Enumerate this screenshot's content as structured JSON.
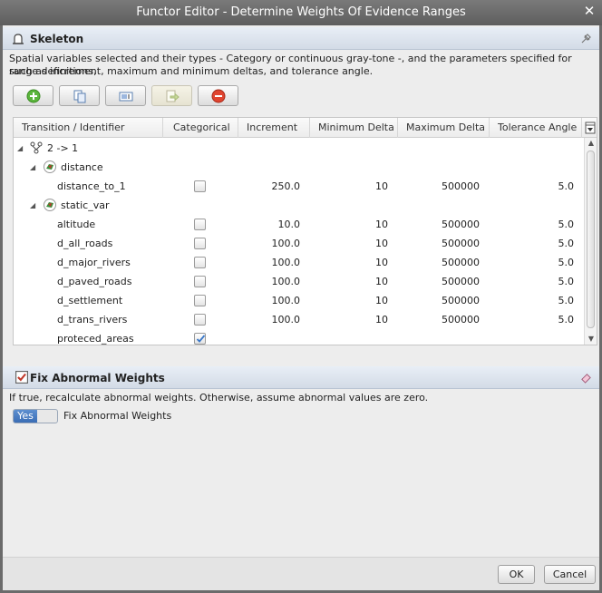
{
  "window": {
    "title": "Functor Editor - Determine Weights Of Evidence Ranges"
  },
  "skeleton": {
    "title": "Skeleton",
    "description_line1": "Spatial variables selected and their types - Category or continuous gray-tone -, and the parameters specified for range definitions,",
    "description_line2": "such as increment, maximum and minimum deltas, and tolerance angle."
  },
  "toolbar": {
    "buttons": [
      {
        "icon": "add-icon"
      },
      {
        "icon": "copy-icon"
      },
      {
        "icon": "edit-icon"
      },
      {
        "icon": "import-icon"
      },
      {
        "icon": "remove-icon"
      }
    ]
  },
  "grid": {
    "columns": [
      "Transition / Identifier",
      "Categorical",
      "Increment",
      "Minimum Delta",
      "Maximum Delta",
      "Tolerance Angle"
    ],
    "rows": [
      {
        "type": "root",
        "label": "2 -> 1"
      },
      {
        "type": "group",
        "label": "distance"
      },
      {
        "type": "var",
        "label": "distance_to_1",
        "categorical": false,
        "increment": "250.0",
        "min_delta": "10",
        "max_delta": "500000",
        "tolerance": "5.0"
      },
      {
        "type": "group",
        "label": "static_var"
      },
      {
        "type": "var",
        "label": "altitude",
        "categorical": false,
        "increment": "10.0",
        "min_delta": "10",
        "max_delta": "500000",
        "tolerance": "5.0"
      },
      {
        "type": "var",
        "label": "d_all_roads",
        "categorical": false,
        "increment": "100.0",
        "min_delta": "10",
        "max_delta": "500000",
        "tolerance": "5.0"
      },
      {
        "type": "var",
        "label": "d_major_rivers",
        "categorical": false,
        "increment": "100.0",
        "min_delta": "10",
        "max_delta": "500000",
        "tolerance": "5.0"
      },
      {
        "type": "var",
        "label": "d_paved_roads",
        "categorical": false,
        "increment": "100.0",
        "min_delta": "10",
        "max_delta": "500000",
        "tolerance": "5.0"
      },
      {
        "type": "var",
        "label": "d_settlement",
        "categorical": false,
        "increment": "100.0",
        "min_delta": "10",
        "max_delta": "500000",
        "tolerance": "5.0"
      },
      {
        "type": "var",
        "label": "d_trans_rivers",
        "categorical": false,
        "increment": "100.0",
        "min_delta": "10",
        "max_delta": "500000",
        "tolerance": "5.0"
      },
      {
        "type": "var",
        "label": "proteced_areas",
        "categorical": true,
        "increment": "",
        "min_delta": "",
        "max_delta": "",
        "tolerance": ""
      }
    ]
  },
  "fix_weights": {
    "title": "Fix Abnormal Weights",
    "checked": true,
    "description": "If true, recalculate abnormal weights. Otherwise, assume abnormal values are zero.",
    "toggle_value": "Yes",
    "toggle_label": "Fix Abnormal Weights"
  },
  "footer": {
    "ok_label": "OK",
    "cancel_label": "Cancel"
  }
}
